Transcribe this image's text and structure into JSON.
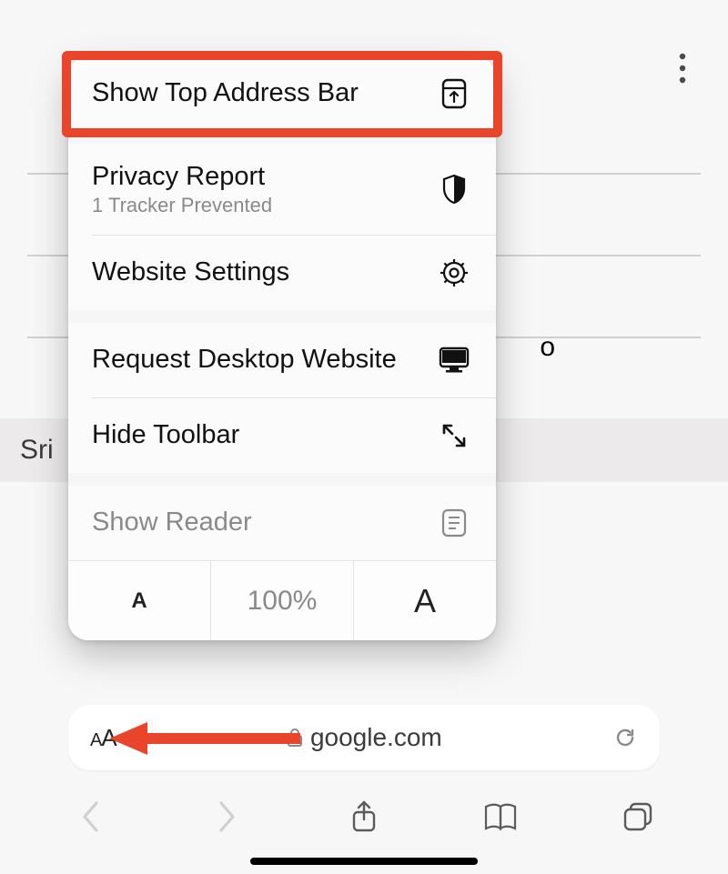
{
  "background": {
    "footer_label": "Sri",
    "overflow_char": "o"
  },
  "popover": {
    "items": {
      "show_top": {
        "label": "Show Top Address Bar"
      },
      "privacy": {
        "label": "Privacy Report",
        "sub": "1 Tracker Prevented"
      },
      "website_settings": {
        "label": "Website Settings"
      },
      "desktop": {
        "label": "Request Desktop Website"
      },
      "hide_toolbar": {
        "label": "Hide Toolbar"
      },
      "show_reader": {
        "label": "Show Reader"
      }
    },
    "textsize": {
      "smaller": "A",
      "zoom": "100%",
      "larger": "A"
    }
  },
  "addressbar": {
    "aA_small": "A",
    "aA_big": "A",
    "domain": "google.com"
  },
  "annotation": {
    "arrow_color": "#e9452a"
  }
}
